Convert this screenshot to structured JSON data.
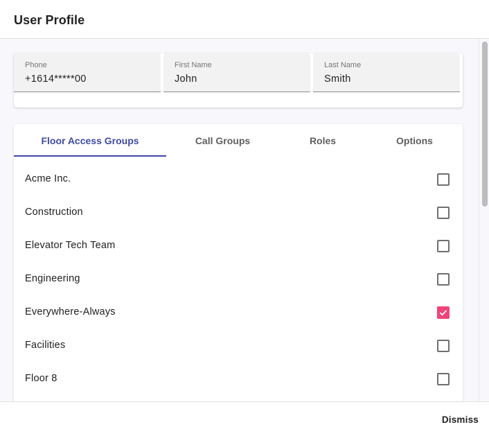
{
  "dialog": {
    "title": "User Profile",
    "dismiss_label": "Dismiss"
  },
  "fields": [
    {
      "label": "Phone",
      "value": "+1614*****00"
    },
    {
      "label": "First Name",
      "value": "John"
    },
    {
      "label": "Last Name",
      "value": "Smith"
    }
  ],
  "tabs": [
    {
      "label": "Floor Access Groups",
      "active": true
    },
    {
      "label": "Call Groups",
      "active": false
    },
    {
      "label": "Roles",
      "active": false
    },
    {
      "label": "Options",
      "active": false
    }
  ],
  "colors": {
    "accent": "#3f4aa5",
    "checkbox_checked": "#f0437a"
  },
  "floor_access_groups": [
    {
      "name": "Acme Inc.",
      "checked": false
    },
    {
      "name": "Construction",
      "checked": false
    },
    {
      "name": "Elevator Tech Team",
      "checked": false
    },
    {
      "name": "Engineering",
      "checked": false
    },
    {
      "name": "Everywhere-Always",
      "checked": true
    },
    {
      "name": "Facilities",
      "checked": false
    },
    {
      "name": "Floor 8",
      "checked": false
    }
  ]
}
